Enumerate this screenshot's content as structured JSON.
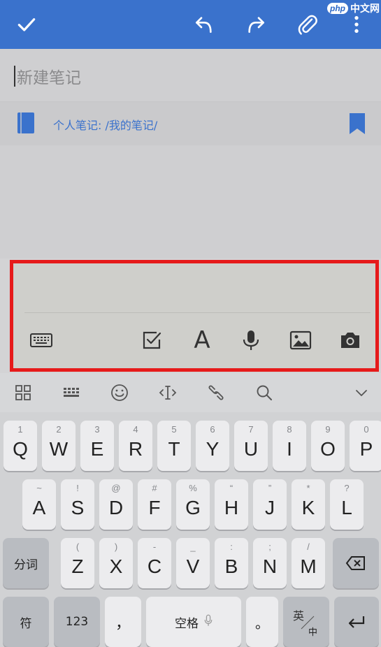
{
  "watermark": {
    "brand": "php",
    "site": "中文网"
  },
  "note": {
    "title_placeholder": "新建笔记",
    "notebook_path": "个人笔记: /我的笔记/"
  },
  "toolbar": {
    "icons": [
      "keyboard-icon",
      "checkbox-icon",
      "font-icon",
      "microphone-icon",
      "image-icon",
      "camera-icon"
    ],
    "font_glyph": "A"
  },
  "keyboard": {
    "strip_icons": [
      "grid-icon",
      "keyboard-layout-icon",
      "emoji-icon",
      "cursor-move-icon",
      "clip-icon",
      "search-icon",
      "chevron-down-icon"
    ],
    "row1": [
      {
        "k": "Q",
        "h": "1"
      },
      {
        "k": "W",
        "h": "2"
      },
      {
        "k": "E",
        "h": "3"
      },
      {
        "k": "R",
        "h": "4"
      },
      {
        "k": "T",
        "h": "5"
      },
      {
        "k": "Y",
        "h": "6"
      },
      {
        "k": "U",
        "h": "7"
      },
      {
        "k": "I",
        "h": "8"
      },
      {
        "k": "O",
        "h": "9"
      },
      {
        "k": "P",
        "h": "0"
      }
    ],
    "row2": [
      {
        "k": "A",
        "h": "~"
      },
      {
        "k": "S",
        "h": "!"
      },
      {
        "k": "D",
        "h": "@"
      },
      {
        "k": "F",
        "h": "#"
      },
      {
        "k": "G",
        "h": "%"
      },
      {
        "k": "H",
        "h": "“"
      },
      {
        "k": "J",
        "h": "”"
      },
      {
        "k": "K",
        "h": "*"
      },
      {
        "k": "L",
        "h": "?"
      }
    ],
    "row3": [
      {
        "k": "Z",
        "h": "("
      },
      {
        "k": "X",
        "h": ")"
      },
      {
        "k": "C",
        "h": "-"
      },
      {
        "k": "V",
        "h": "_"
      },
      {
        "k": "B",
        "h": ":"
      },
      {
        "k": "N",
        "h": ";"
      },
      {
        "k": "M",
        "h": "/"
      }
    ],
    "segment_key": "分词",
    "symbol_key": "符",
    "number_key": "123",
    "comma_key": "，",
    "space_key": "空格",
    "period_key": "。",
    "lang_top": "英",
    "lang_bottom": "中"
  },
  "colors": {
    "accent": "#3a72cc",
    "highlight": "#e61a1a"
  }
}
